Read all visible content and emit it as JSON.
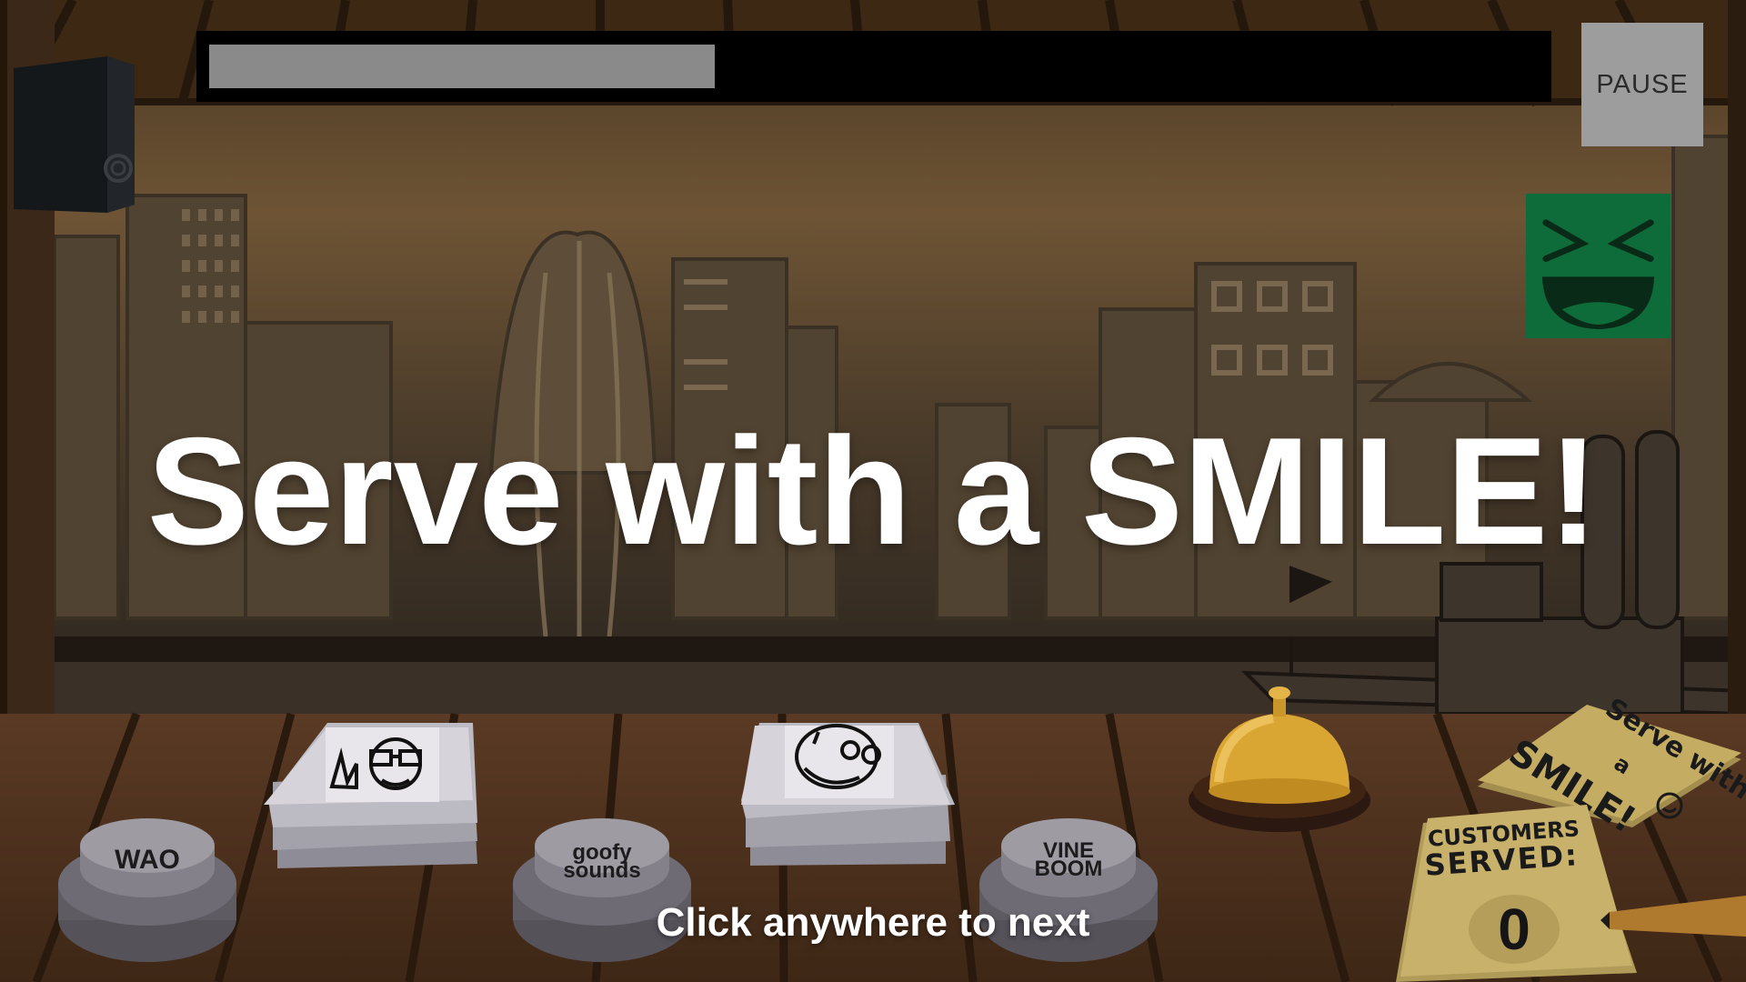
{
  "hud": {
    "pause_label": "PAUSE",
    "progress_fraction": 0.38
  },
  "mood_indicator": {
    "icon": "laughing-face-icon",
    "color": "#0e6b3a"
  },
  "banner": {
    "text": "Serve with a SMILE!"
  },
  "hint": {
    "text": "Click anywhere to next"
  },
  "soundboard": [
    {
      "label_lines": [
        "WAO"
      ]
    },
    {
      "label_lines": [
        "goofy",
        "sounds"
      ]
    },
    {
      "label_lines": [
        "VINE",
        "BOOM"
      ]
    }
  ],
  "paper_stacks": [
    {
      "icon": "meme-face-glasses-icon"
    },
    {
      "icon": "laughing-skull-face-icon"
    }
  ],
  "service_bell": {
    "icon": "service-bell-icon"
  },
  "sign": {
    "lines": [
      "Serve with",
      "a",
      "SMILE!"
    ]
  },
  "counter": {
    "title_lines": [
      "CUSTOMERS",
      "SERVED:"
    ],
    "value": "0"
  }
}
